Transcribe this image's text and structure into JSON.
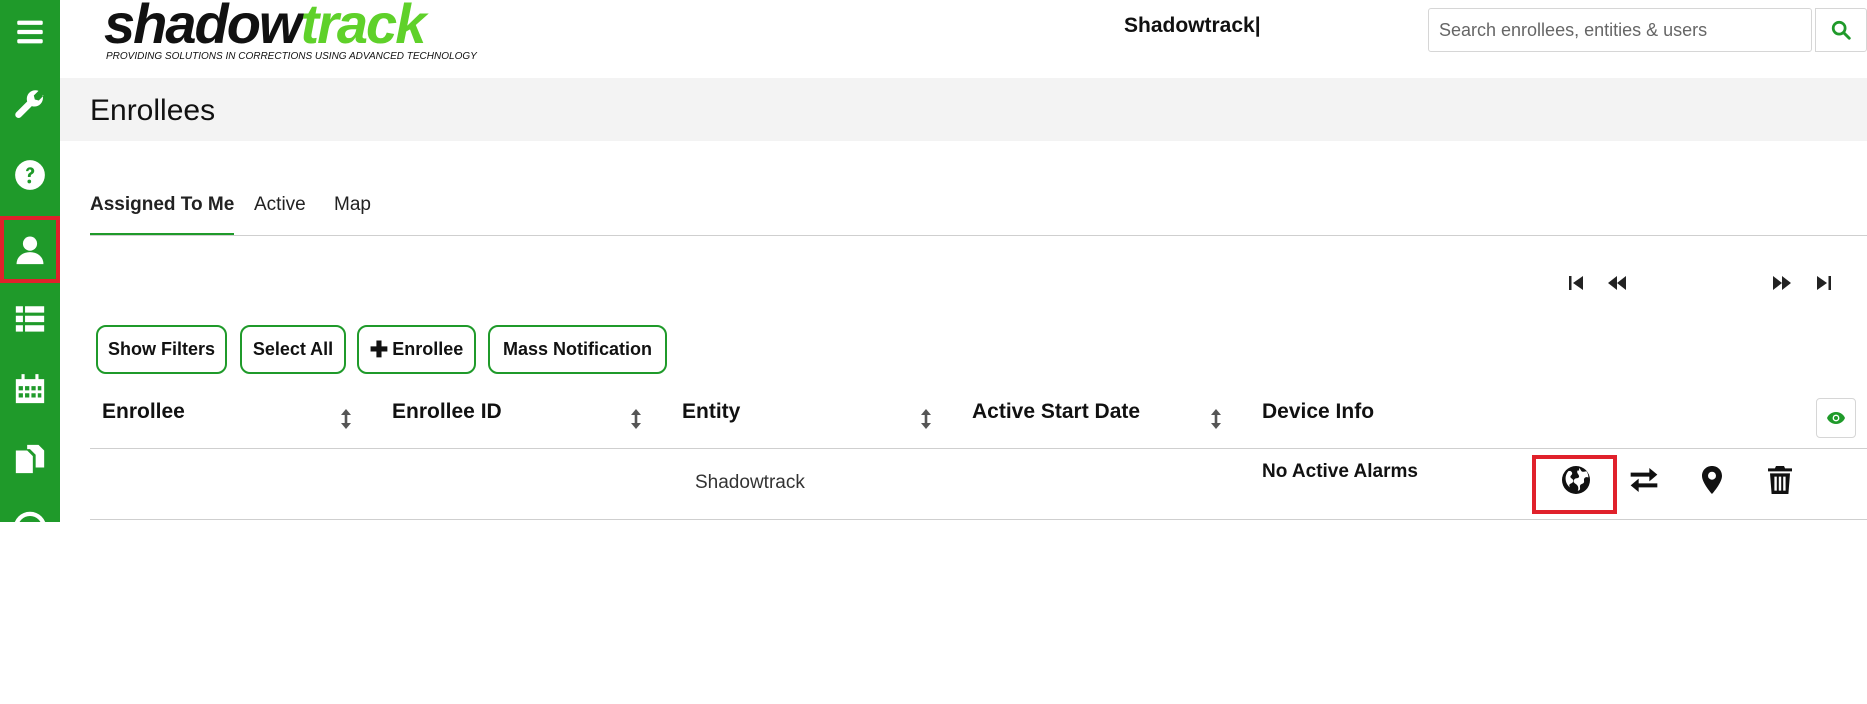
{
  "brand": {
    "logo_part1": "shadow",
    "logo_part2": "track",
    "tagline": "PROVIDING SOLUTIONS IN CORRECTIONS USING ADVANCED TECHNOLOGY",
    "app_title": "Shadowtrack|",
    "accent": "#1f9a2a",
    "logo_green": "#5fd12a",
    "highlight": "#e0212b"
  },
  "sidebar": {
    "items": [
      {
        "icon": "hamburger-menu-icon"
      },
      {
        "icon": "wrench-icon"
      },
      {
        "icon": "help-circle-icon"
      },
      {
        "icon": "user-icon",
        "selected": true
      },
      {
        "icon": "list-icon"
      },
      {
        "icon": "calendar-icon"
      },
      {
        "icon": "copy-documents-icon"
      },
      {
        "icon": "circle-icon"
      }
    ]
  },
  "search": {
    "placeholder": "Search enrollees, entities & users",
    "icon": "search-icon"
  },
  "page": {
    "title": "Enrollees"
  },
  "tabs": [
    {
      "label": "Assigned To Me",
      "active": true
    },
    {
      "label": "Active",
      "active": false
    },
    {
      "label": "Map",
      "active": false
    }
  ],
  "pager": {
    "icons": [
      "first-page-icon",
      "previous-page-icon",
      "next-page-icon",
      "last-page-icon"
    ]
  },
  "toolbar": {
    "show_filters": "Show Filters",
    "select_all": "Select All",
    "plus": "✚",
    "add_enrollee": "Enrollee",
    "mass_notification": "Mass Notification"
  },
  "table": {
    "columns": [
      "Enrollee",
      "Enrollee ID",
      "Entity",
      "Active Start Date",
      "Device Info"
    ],
    "rows": [
      {
        "enrollee": "",
        "enrollee_id": "",
        "entity": "Shadowtrack",
        "active_start_date": "",
        "device_info": "No Active Alarms",
        "actions": [
          "globe-icon",
          "transfer-arrows-icon",
          "map-pin-icon",
          "trash-icon"
        ]
      }
    ]
  }
}
